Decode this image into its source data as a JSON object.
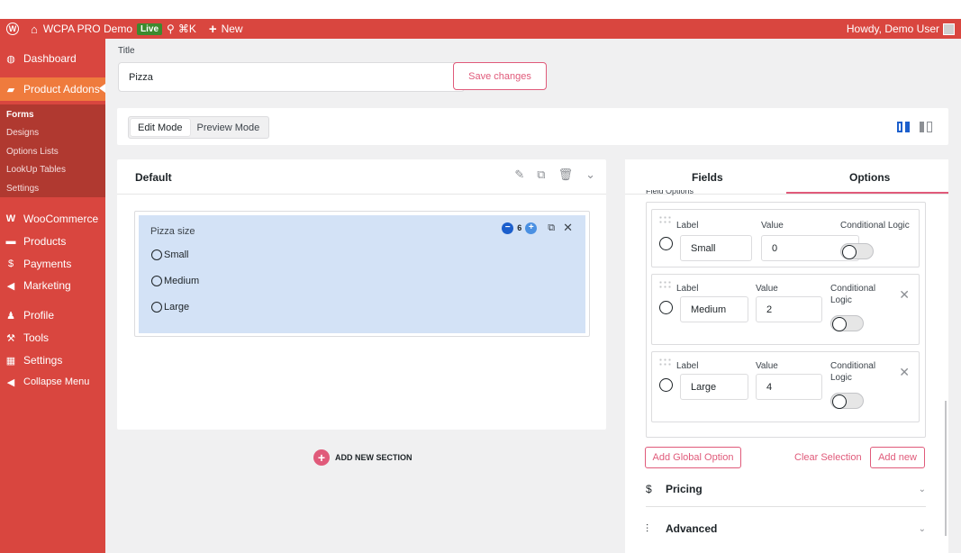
{
  "adminbar": {
    "site_name": "WCPA PRO Demo",
    "live_badge": "Live",
    "shortcut": "⌘K",
    "new_label": "New",
    "howdy": "Howdy, Demo User"
  },
  "sidebar": {
    "items": [
      {
        "label": "Dashboard",
        "icon": "dashboard-icon"
      },
      {
        "label": "Product Addons",
        "icon": "product-addons-icon",
        "active": true
      },
      {
        "label": "WooCommerce",
        "icon": "woocommerce-icon"
      },
      {
        "label": "Products",
        "icon": "products-icon"
      },
      {
        "label": "Payments",
        "icon": "payments-icon"
      },
      {
        "label": "Marketing",
        "icon": "marketing-icon"
      },
      {
        "label": "Profile",
        "icon": "profile-icon"
      },
      {
        "label": "Tools",
        "icon": "tools-icon"
      },
      {
        "label": "Settings",
        "icon": "settings-icon"
      },
      {
        "label": "Collapse Menu",
        "icon": "collapse-icon"
      }
    ],
    "submenu": [
      "Forms",
      "Designs",
      "Options Lists",
      "LookUp Tables",
      "Settings"
    ]
  },
  "form": {
    "title_label": "Title",
    "title_value": "Pizza",
    "save_label": "Save changes"
  },
  "modes": {
    "edit": "Edit Mode",
    "preview": "Preview Mode"
  },
  "section": {
    "title": "Default",
    "field": {
      "label": "Pizza size",
      "width": "6",
      "options": [
        "Small",
        "Medium",
        "Large"
      ]
    },
    "add_section": "ADD NEW SECTION"
  },
  "panel": {
    "tabs": [
      "Fields",
      "Options"
    ],
    "cut_heading": "Field Options",
    "label_header": "Label",
    "value_header": "Value",
    "cond_header": "Conditional Logic",
    "cond_line1": "Conditional",
    "cond_line2": "Logic",
    "options": [
      {
        "label": "Small",
        "value": "0"
      },
      {
        "label": "Medium",
        "value": "2"
      },
      {
        "label": "Large",
        "value": "4"
      }
    ],
    "global_option": "Add Global Option",
    "clear_selection": "Clear Selection",
    "add_new": "Add new",
    "pricing": "Pricing",
    "advanced": "Advanced"
  },
  "colors": {
    "admin_red": "#d9463f",
    "active_orange": "#ef7b3d",
    "accent_pink": "#e05a7a",
    "field_blue": "#d3e2f6",
    "control_blue": "#1c5fcc"
  }
}
